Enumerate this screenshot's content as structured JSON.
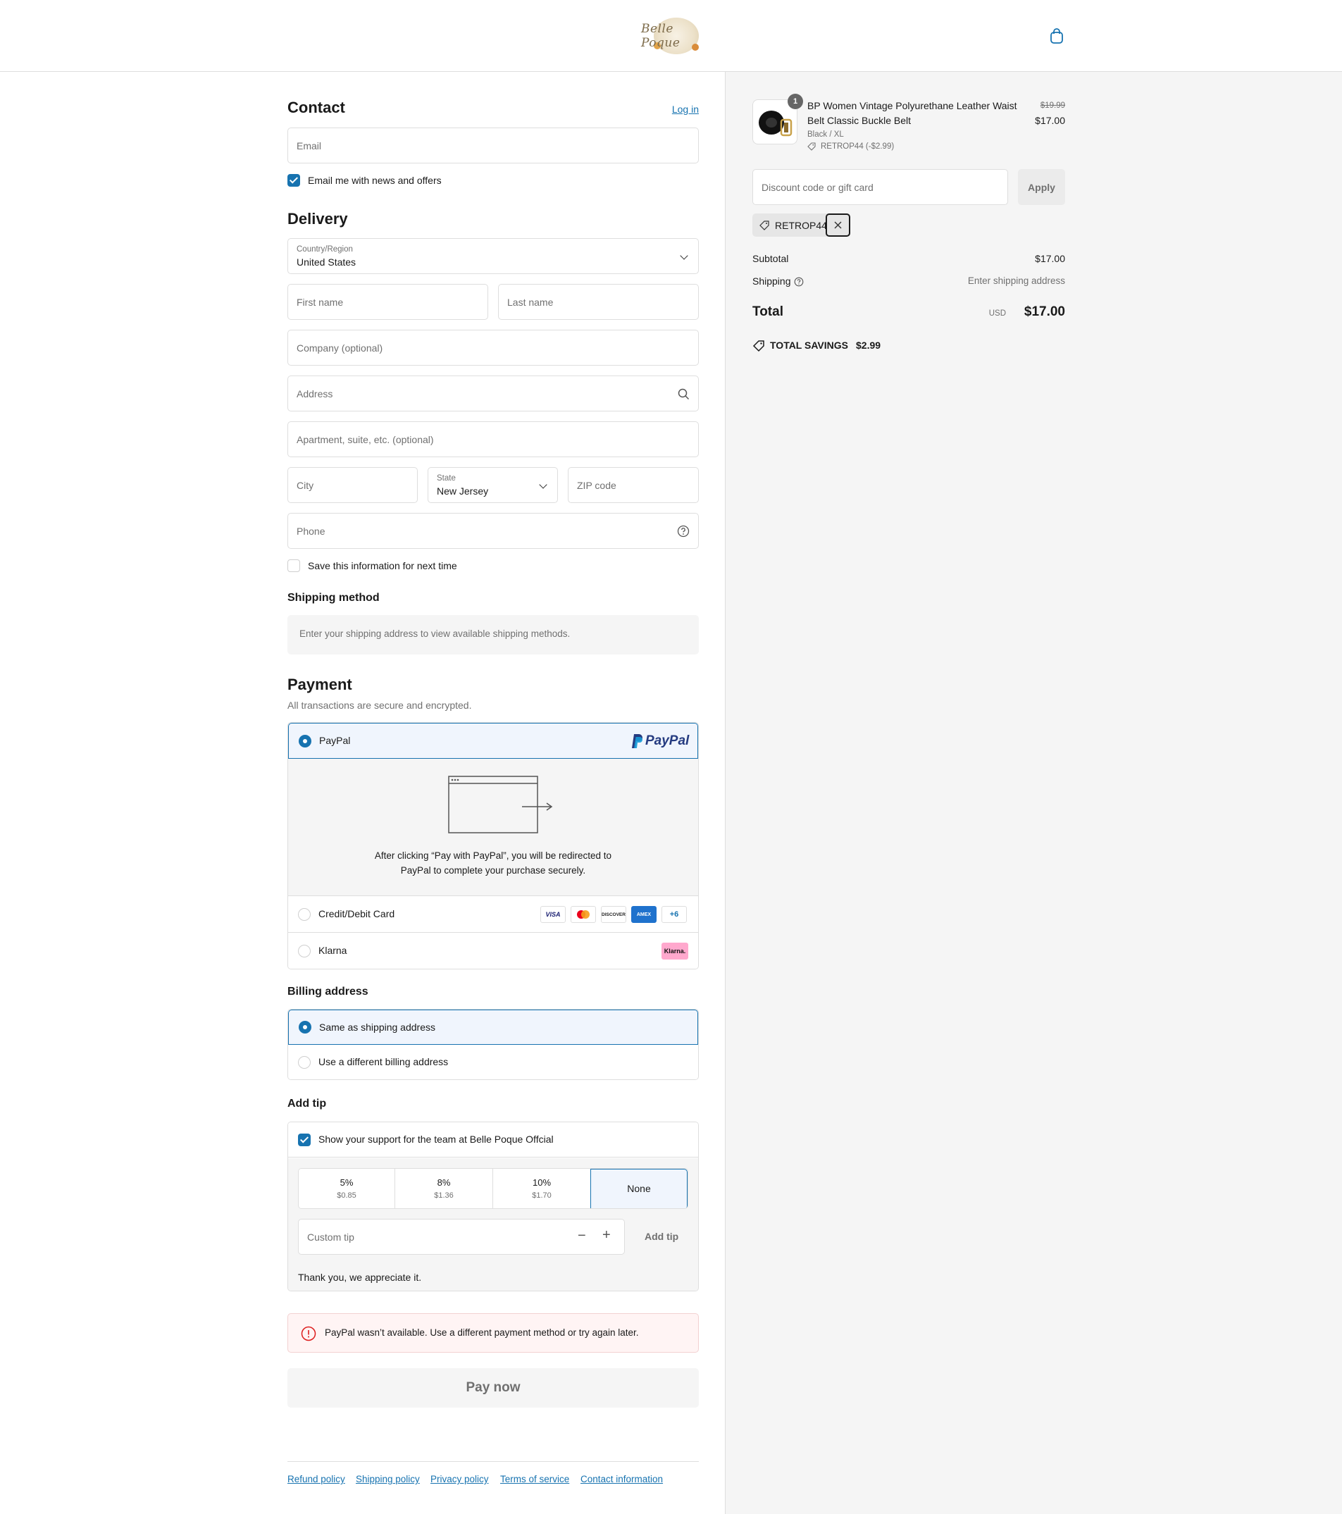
{
  "header": {
    "brand": "Belle Poque",
    "cart_icon": "bag-icon"
  },
  "contact": {
    "title": "Contact",
    "login_link": "Log in",
    "email_placeholder": "Email",
    "news_checkbox_label": "Email me with news and offers",
    "news_checked": true
  },
  "delivery": {
    "title": "Delivery",
    "country_label": "Country/Region",
    "country_value": "United States",
    "first_name_placeholder": "First name",
    "last_name_placeholder": "Last name",
    "company_placeholder": "Company (optional)",
    "address_placeholder": "Address",
    "apartment_placeholder": "Apartment, suite, etc. (optional)",
    "city_placeholder": "City",
    "state_label": "State",
    "state_value": "New Jersey",
    "zip_placeholder": "ZIP code",
    "phone_placeholder": "Phone",
    "save_info_label": "Save this information for next time",
    "save_info_checked": false
  },
  "shipping_method": {
    "title": "Shipping method",
    "message": "Enter your shipping address to view available shipping methods."
  },
  "payment": {
    "title": "Payment",
    "subtitle": "All transactions are secure and encrypted.",
    "paypal_label": "PayPal",
    "paypal_logo": "PayPal",
    "paypal_note": "After clicking “Pay with PayPal”, you will be redirected to PayPal to complete your purchase securely.",
    "card_label": "Credit/Debit Card",
    "card_logos": [
      "VISA",
      "Mastercard",
      "DISCOVER",
      "AMEX",
      "+6"
    ],
    "klarna_label": "Klarna",
    "klarna_logo": "Klarna.",
    "selected": "PayPal"
  },
  "billing": {
    "title": "Billing address",
    "same_label": "Same as shipping address",
    "different_label": "Use a different billing address",
    "selected": "same"
  },
  "tip": {
    "title": "Add tip",
    "support_label": "Show your support for the team at Belle Poque Offcial",
    "support_checked": true,
    "options": [
      {
        "pct": "5%",
        "amount": "$0.85"
      },
      {
        "pct": "8%",
        "amount": "$1.36"
      },
      {
        "pct": "10%",
        "amount": "$1.70"
      },
      {
        "pct": "None",
        "amount": ""
      }
    ],
    "selected": "None",
    "custom_placeholder": "Custom tip",
    "add_button": "Add tip",
    "thanks": "Thank you, we appreciate it."
  },
  "error": {
    "message": "PayPal wasn’t available. Use a different payment method or try again later."
  },
  "pay_button": "Pay now",
  "footer_links": [
    "Refund policy",
    "Shipping policy",
    "Privacy policy",
    "Terms of service",
    "Contact information"
  ],
  "summary": {
    "product": {
      "quantity": "1",
      "name_line1": "BP Women Vintage Polyurethane Leather Waist",
      "name_line2": "Belt Classic Buckle Belt",
      "variant": "Black / XL",
      "discount_tag": "RETROP44 (-$2.99)",
      "original_price": "$19.99",
      "price": "$17.00"
    },
    "discount_placeholder": "Discount code or gift card",
    "apply_button": "Apply",
    "applied_code": "RETROP44",
    "subtotal_label": "Subtotal",
    "subtotal_value": "$17.00",
    "shipping_label": "Shipping",
    "shipping_value": "Enter shipping address",
    "total_label": "Total",
    "currency": "USD",
    "total_value": "$17.00",
    "savings_label": "TOTAL SAVINGS",
    "savings_value": "$2.99"
  },
  "colors": {
    "accent": "#1773b0",
    "error": "#dd1d1d",
    "panel": "#f5f5f5"
  }
}
